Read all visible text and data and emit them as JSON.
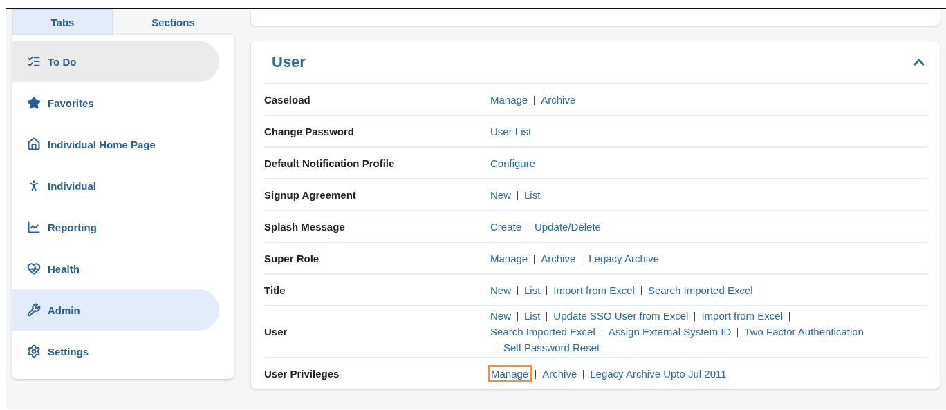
{
  "sidebar": {
    "tabs": [
      {
        "label": "Tabs",
        "selected": true
      },
      {
        "label": "Sections",
        "selected": false
      }
    ],
    "items": [
      {
        "label": "To Do",
        "selected": false,
        "hovered": true
      },
      {
        "label": "Favorites",
        "selected": false,
        "hovered": false
      },
      {
        "label": "Individual Home Page",
        "selected": false,
        "hovered": false
      },
      {
        "label": "Individual",
        "selected": false,
        "hovered": false
      },
      {
        "label": "Reporting",
        "selected": false,
        "hovered": false
      },
      {
        "label": "Health",
        "selected": false,
        "hovered": false
      },
      {
        "label": "Admin",
        "selected": true,
        "hovered": false
      },
      {
        "label": "Settings",
        "selected": false,
        "hovered": false
      }
    ]
  },
  "section": {
    "title": "User",
    "expanded": true,
    "rows": [
      {
        "name": "Caseload",
        "links": [
          {
            "label": "Manage",
            "highlighted": false
          },
          {
            "label": "Archive",
            "highlighted": false
          }
        ]
      },
      {
        "name": "Change Password",
        "links": [
          {
            "label": "User List",
            "highlighted": false
          }
        ]
      },
      {
        "name": "Default Notification Profile",
        "links": [
          {
            "label": "Configure",
            "highlighted": false
          }
        ]
      },
      {
        "name": "Signup Agreement",
        "links": [
          {
            "label": "New",
            "highlighted": false
          },
          {
            "label": "List",
            "highlighted": false
          }
        ]
      },
      {
        "name": "Splash Message",
        "links": [
          {
            "label": "Create",
            "highlighted": false
          },
          {
            "label": "Update/Delete",
            "highlighted": false
          }
        ]
      },
      {
        "name": "Super Role",
        "links": [
          {
            "label": "Manage",
            "highlighted": false
          },
          {
            "label": "Archive",
            "highlighted": false
          },
          {
            "label": "Legacy Archive",
            "highlighted": false
          }
        ]
      },
      {
        "name": "Title",
        "links": [
          {
            "label": "New",
            "highlighted": false
          },
          {
            "label": "List",
            "highlighted": false
          },
          {
            "label": "Import from Excel",
            "highlighted": false
          },
          {
            "label": "Search Imported Excel",
            "highlighted": false
          }
        ]
      },
      {
        "name": "User",
        "links": [
          {
            "label": "New",
            "highlighted": false
          },
          {
            "label": "List",
            "highlighted": false
          },
          {
            "label": "Update SSO User from Excel",
            "highlighted": false
          },
          {
            "label": "Import from Excel",
            "highlighted": false
          },
          {
            "label": "Search Imported Excel",
            "highlighted": false
          },
          {
            "label": "Assign External System ID",
            "highlighted": false
          },
          {
            "label": "Two Factor Authentication",
            "highlighted": false
          },
          {
            "label": "Self Password Reset",
            "highlighted": false
          }
        ]
      },
      {
        "name": "User Privileges",
        "links": [
          {
            "label": "Manage",
            "highlighted": true
          },
          {
            "label": "Archive",
            "highlighted": false
          },
          {
            "label": "Legacy Archive Upto Jul 2011",
            "highlighted": false
          }
        ]
      }
    ]
  }
}
